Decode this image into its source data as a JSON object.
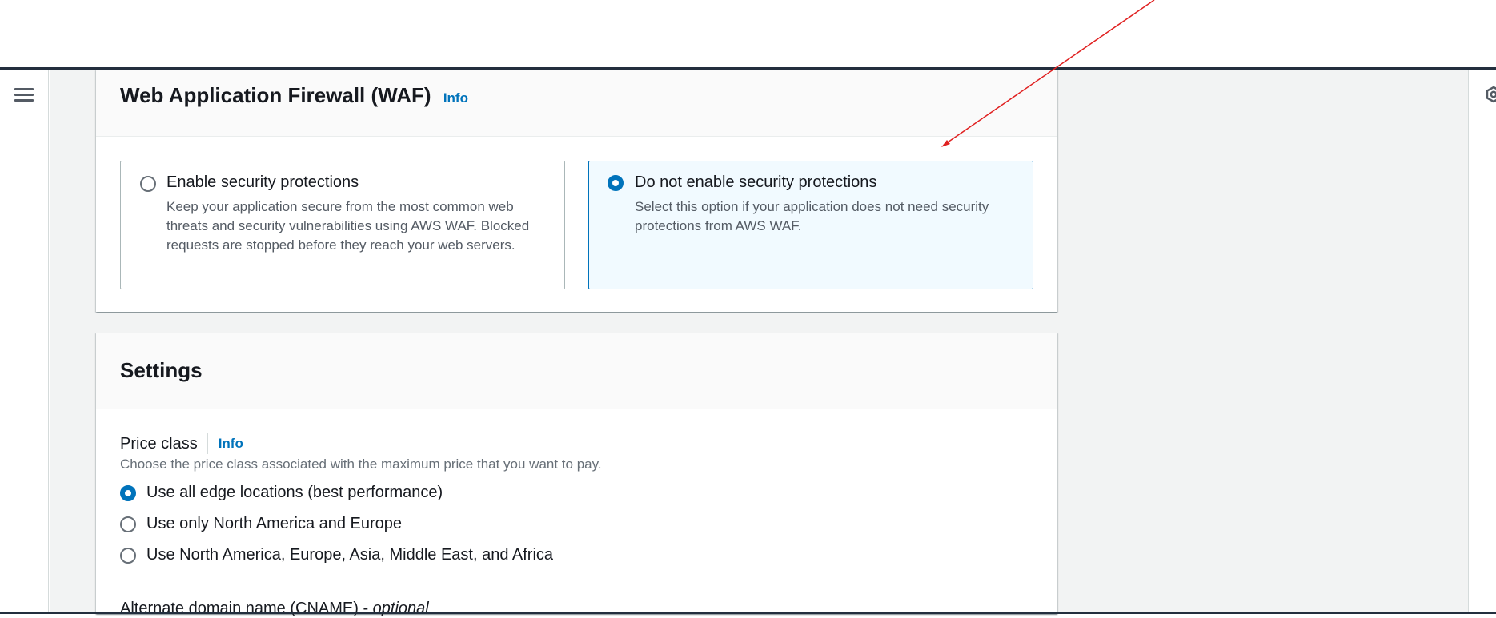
{
  "waf": {
    "title": "Web Application Firewall (WAF)",
    "info": "Info",
    "options": [
      {
        "title": "Enable security protections",
        "description": "Keep your application secure from the most common web threats and security vulnerabilities using AWS WAF. Blocked requests are stopped before they reach your web servers.",
        "selected": false
      },
      {
        "title": "Do not enable security protections",
        "description": "Select this option if your application does not need security protections from AWS WAF.",
        "selected": true
      }
    ]
  },
  "settings": {
    "title": "Settings",
    "price_class": {
      "label": "Price class",
      "info": "Info",
      "description": "Choose the price class associated with the maximum price that you want to pay.",
      "options": [
        {
          "label": "Use all edge locations (best performance)",
          "selected": true
        },
        {
          "label": "Use only North America and Europe",
          "selected": false
        },
        {
          "label": "Use North America, Europe, Asia, Middle East, and Africa",
          "selected": false
        }
      ]
    },
    "cname": {
      "label": "Alternate domain name (CNAME) - ",
      "optional": "optional"
    }
  },
  "colors": {
    "accent": "#0073bb",
    "annotation_arrow": "#e02020",
    "topbar": "#232f3e"
  },
  "icons": {
    "menu": "hamburger-menu-icon",
    "settings": "settings-gear-icon"
  }
}
